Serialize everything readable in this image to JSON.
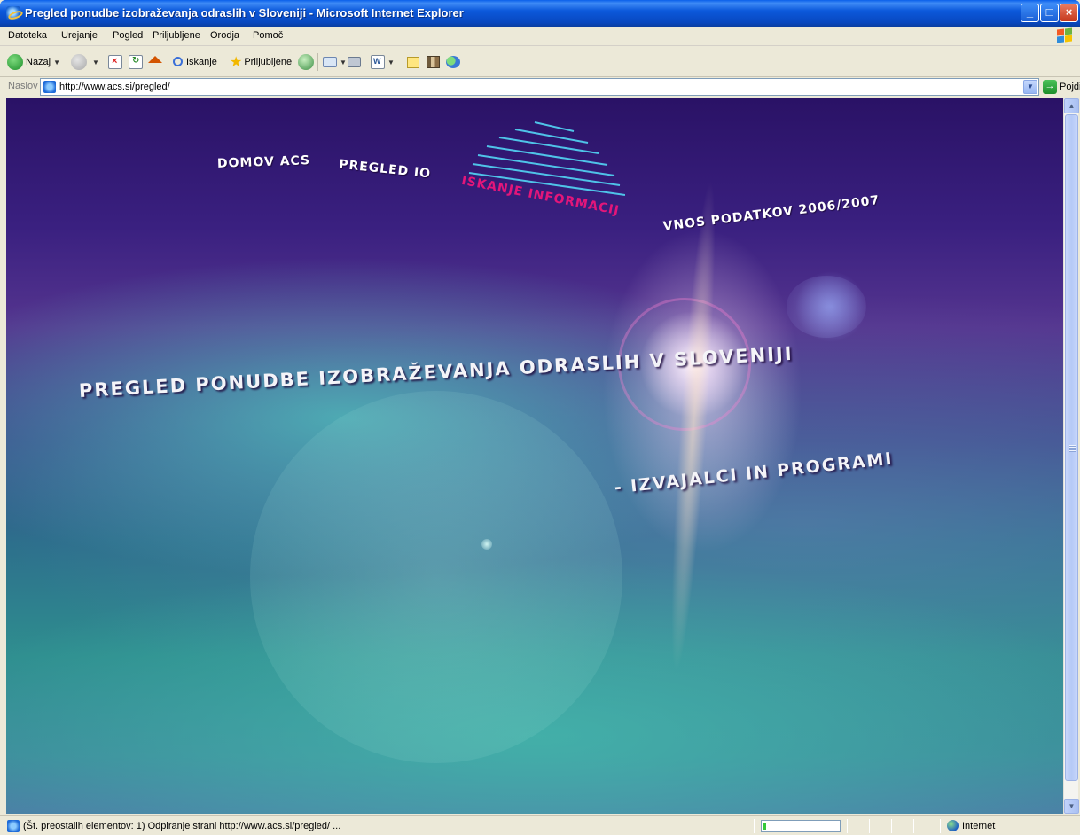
{
  "window": {
    "title": "Pregled ponudbe izobraževanja odraslih v Sloveniji - Microsoft Internet Explorer",
    "controls": [
      "_",
      "□",
      "×"
    ]
  },
  "menu": {
    "items": [
      "Datoteka",
      "Urejanje",
      "Pogled",
      "Priljubljene",
      "Orodja",
      "Pomoč"
    ]
  },
  "toolbar": {
    "back_label": "Nazaj",
    "search_label": "Iskanje",
    "favorites_label": "Priljubljene"
  },
  "address": {
    "label": "Naslov",
    "url": "http://www.acs.si/pregled/",
    "go_label": "Pojdi"
  },
  "page": {
    "nav": [
      {
        "label": "DOMOV ACS",
        "active": false
      },
      {
        "label": "PREGLED IO",
        "active": false
      },
      {
        "label": "ISKANJE INFORMACIJ",
        "active": true
      },
      {
        "label": "VNOS PODATKOV 2006/2007",
        "active": false
      }
    ],
    "headline_line1": "PREGLED PONUDBE IZOBRAŽEVANJA ODRASLIH V SLOVENIJI",
    "headline_line2": "- IZVAJALCI IN PROGRAMI"
  },
  "status": {
    "text": "(Št. preostalih elementov: 1) Odpiranje strani http://www.acs.si/pregled/ ...",
    "progress": 0.04,
    "zone": "Internet"
  },
  "colors": {
    "active_nav": "#E3167A",
    "logo_lines": "#4FC3E8"
  }
}
